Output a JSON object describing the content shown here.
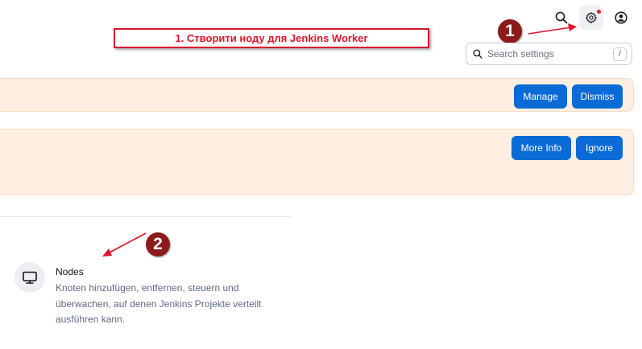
{
  "header": {
    "icons": [
      "search-icon",
      "gear-icon",
      "user-icon"
    ],
    "settings_has_notification": true
  },
  "callout": {
    "text": "1. Створити ноду для Jenkins Worker",
    "color": "#e0152b"
  },
  "steps": {
    "one": "1",
    "two": "2"
  },
  "search": {
    "placeholder": "Search settings",
    "shortcut": "/"
  },
  "banners": [
    {
      "buttons": [
        "Manage",
        "Dismiss"
      ]
    },
    {
      "buttons": [
        "More Info",
        "Ignore"
      ]
    }
  ],
  "nodes": {
    "icon": "monitor-icon",
    "title": "Nodes",
    "description": "Knoten hinzufügen, entfernen, steuern und überwachen, auf denen Jenkins Projekte verteilt ausführen kann."
  },
  "colors": {
    "primary_button": "#0b6bd6",
    "banner_background": "#fdeee1",
    "annotation_red": "#e0152b",
    "badge": "#8b1b1b"
  }
}
